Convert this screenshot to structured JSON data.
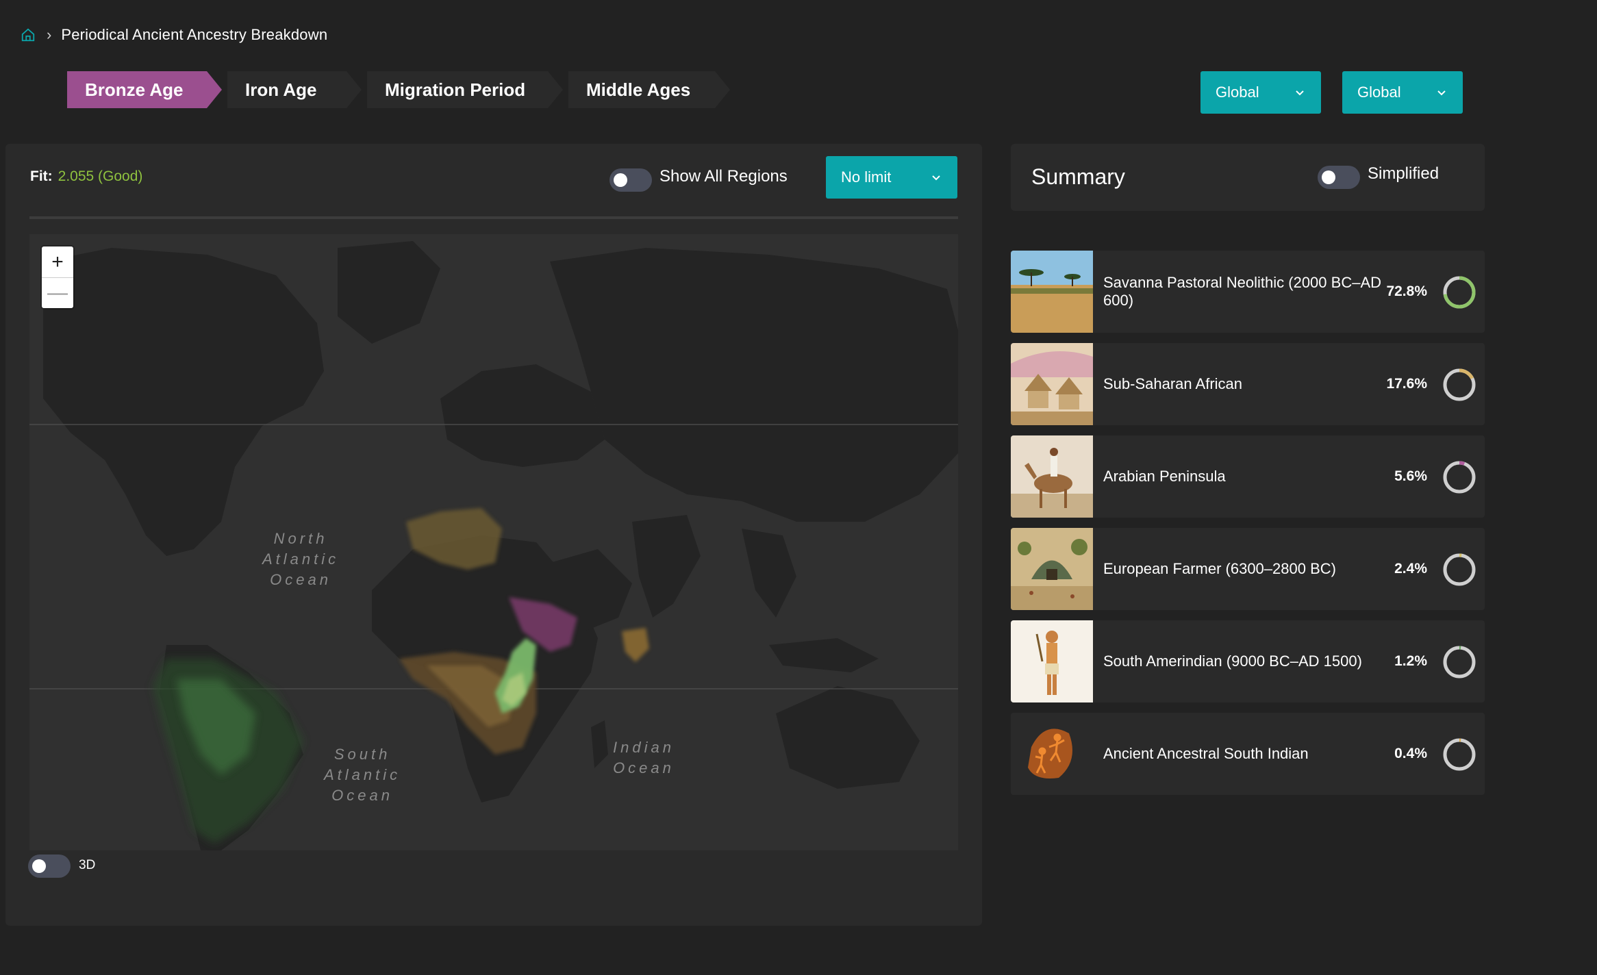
{
  "breadcrumb": {
    "title": "Periodical Ancient Ancestry Breakdown"
  },
  "periods": [
    {
      "label": "Bronze Age",
      "active": true
    },
    {
      "label": "Iron Age",
      "active": false
    },
    {
      "label": "Migration Period",
      "active": false
    },
    {
      "label": "Middle Ages",
      "active": false
    }
  ],
  "filters": {
    "global_1": "Global",
    "global_2": "Global"
  },
  "map_panel": {
    "fit_label": "Fit:",
    "fit_value": "2.055 (Good)",
    "show_all_regions_label": "Show All Regions",
    "limit_value": "No limit",
    "toggle_3d_label": "3D",
    "zoom_in": "+",
    "zoom_out": "—",
    "ocean_labels": {
      "north_atlantic": "North\nAtlantic\nOcean",
      "south_atlantic": "South\nAtlantic\nOcean",
      "indian": "Indian\nOcean"
    }
  },
  "summary": {
    "title": "Summary",
    "simplified_label": "Simplified",
    "ancestries": [
      {
        "name": "Savanna Pastoral Neolithic (2000 BC–AD 600)",
        "percent_label": "72.8%",
        "percent": 72.8,
        "color": "#8fc46a"
      },
      {
        "name": "Sub-Saharan African",
        "percent_label": "17.6%",
        "percent": 17.6,
        "color": "#d9b56a"
      },
      {
        "name": "Arabian Peninsula",
        "percent_label": "5.6%",
        "percent": 5.6,
        "color": "#b05c9e"
      },
      {
        "name": "European Farmer (6300–2800 BC)",
        "percent_label": "2.4%",
        "percent": 2.4,
        "color": "#d8c46b"
      },
      {
        "name": "South Amerindian (9000 BC–AD 1500)",
        "percent_label": "1.2%",
        "percent": 1.2,
        "color": "#63a85a"
      },
      {
        "name": "Ancient Ancestral South Indian",
        "percent_label": "0.4%",
        "percent": 0.4,
        "color": "#d9a94a"
      }
    ]
  },
  "colors": {
    "accent": "#0ba5aa",
    "active_period": "#9b4f8f",
    "fit_good": "#8fc23f",
    "ring_track": "#cfcfcf"
  }
}
